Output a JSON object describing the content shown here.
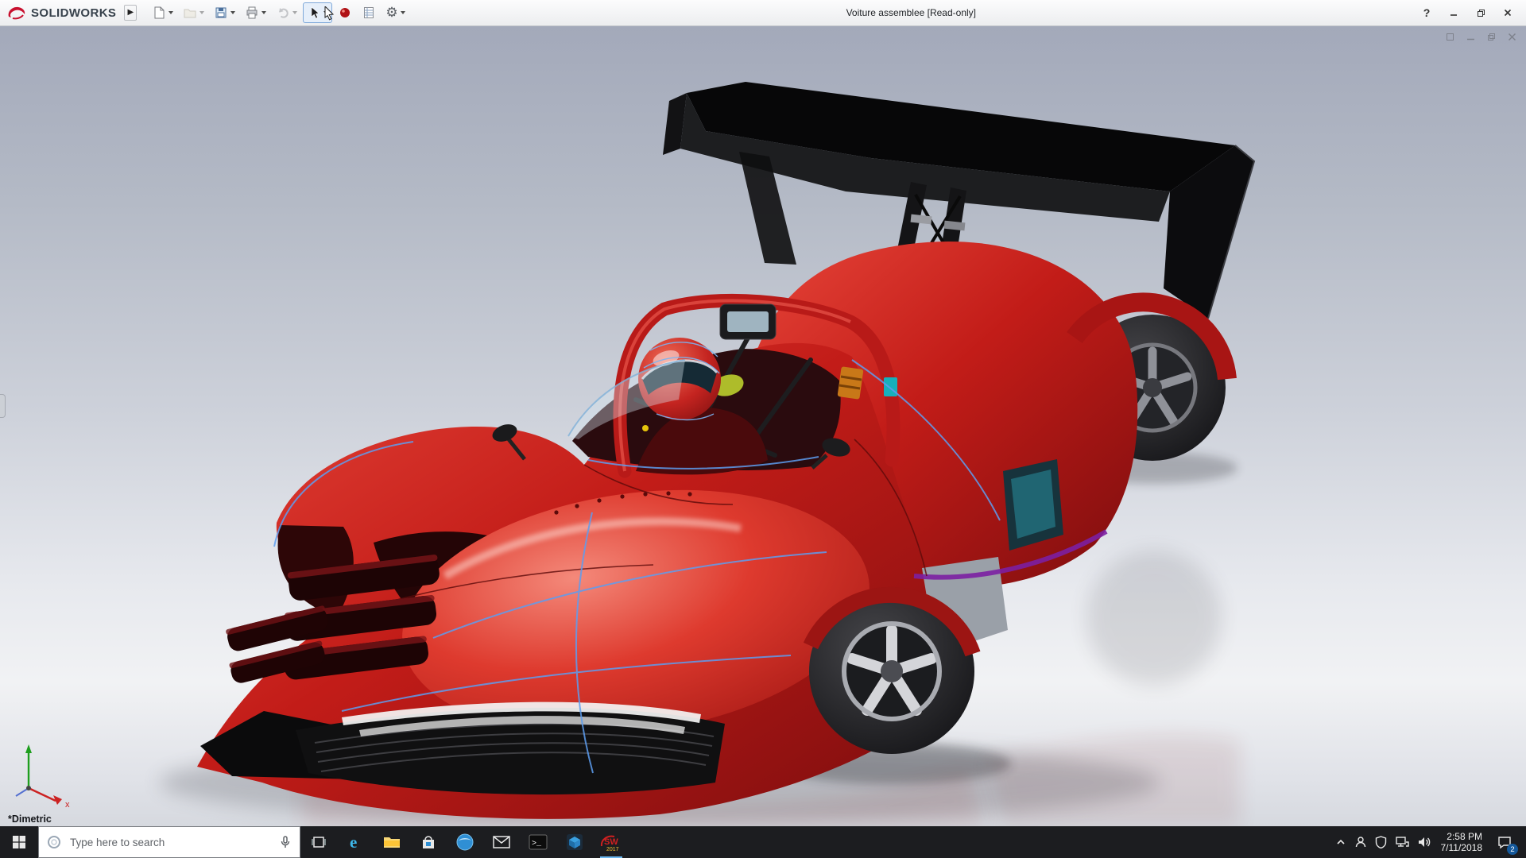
{
  "titlebar": {
    "app_name": "SOLIDWORKS",
    "document_title": "Voiture assemblee [Read-only]",
    "glyphs": {
      "expander": "▶",
      "gear": "⚙",
      "help": "?"
    },
    "tool_icons": [
      "new-document",
      "open",
      "save",
      "print",
      "undo",
      "select",
      "appearance",
      "design-table",
      "options"
    ]
  },
  "viewport": {
    "orientation_label": "*Dimetric",
    "triad": {
      "x_label": "x"
    },
    "model": {
      "description": "Red open-cockpit race car assembly with black rear wing and driver",
      "body_color": "#c21c18",
      "wing_color": "#0d0d0f",
      "sketch_highlight_color": "#5d9df0"
    },
    "window_controls": [
      "restore",
      "minimize",
      "restore-down",
      "close"
    ]
  },
  "taskbar": {
    "search_placeholder": "Type here to search",
    "edge_letter": "e",
    "cmd_glyph": ">_",
    "solidworks_badge": {
      "label": "SW",
      "year": "2017"
    },
    "app_icons": [
      "start",
      "cortana-search",
      "task-view",
      "edge",
      "file-explorer",
      "store",
      "browser",
      "mail",
      "command-prompt",
      "cad-app",
      "solidworks-2017"
    ],
    "tray": {
      "time": "2:58 PM",
      "date": "7/11/2018",
      "notification_count": "2",
      "icons": [
        "hidden-icons-chevron",
        "contact",
        "shield",
        "network",
        "volume",
        "action-center",
        "show-desktop"
      ]
    }
  }
}
